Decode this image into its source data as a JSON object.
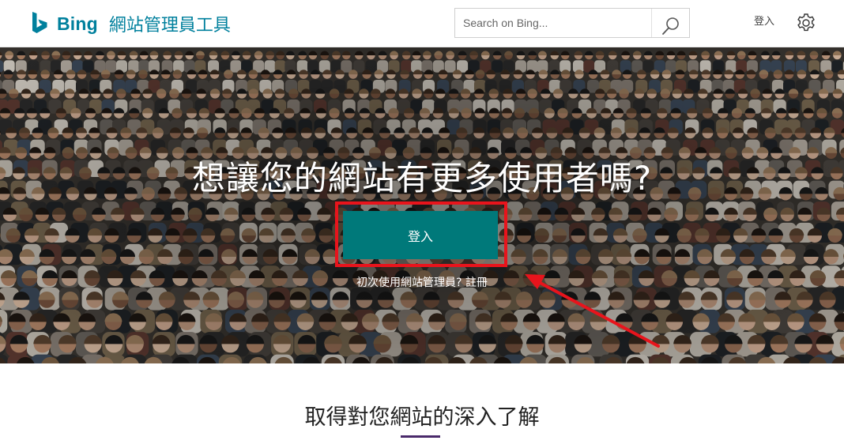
{
  "header": {
    "brand": "Bing",
    "product": "網站管理員工具",
    "search": {
      "placeholder": "Search on Bing..."
    },
    "signin_label": "登入",
    "icons": {
      "logo": "bing-logo-icon",
      "search": "search-icon",
      "settings": "gear-icon"
    },
    "brand_color": "#00809d"
  },
  "hero": {
    "title": "想讓您的網站有更多使用者嗎?",
    "signin_button": "登入",
    "first_time_text": "初次使用網站管理員?",
    "register_link": "註冊",
    "button_color": "#00797a",
    "annotation_color": "#e8141c"
  },
  "section": {
    "heading": "取得對您網站的深入了解",
    "underline_color": "#4a2a6b"
  }
}
